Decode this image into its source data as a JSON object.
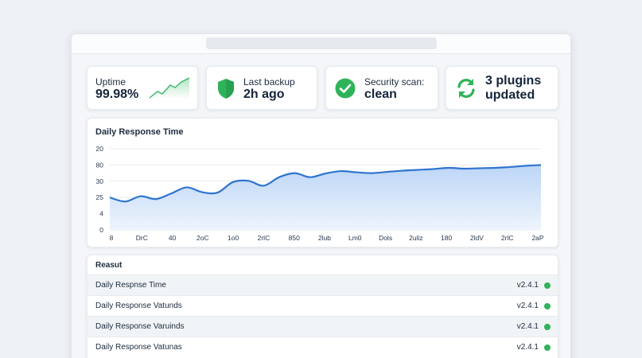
{
  "stats": [
    {
      "label": "Uptime",
      "value": "99.98%",
      "icon": "sparkline-icon"
    },
    {
      "label": "Last backup",
      "value": "2h ago",
      "icon": "shield-icon"
    },
    {
      "label": "Security scan:",
      "value": "clean",
      "icon": "check-circle-icon"
    },
    {
      "label": "",
      "value": "3 plugins\nupdated",
      "value_line1": "3 plugins",
      "value_line2": "updated",
      "icon": "refresh-icon"
    }
  ],
  "colors": {
    "accent": "#2f74d0",
    "success": "#2fb35a",
    "area_top": "#bcd6f7"
  },
  "chart_data": {
    "type": "area",
    "title": "Daily Response Time",
    "y_tick_labels": [
      "20",
      "80",
      "30",
      "25",
      "4",
      "0"
    ],
    "x_tick_labels": [
      "8",
      "DrC",
      "40",
      "2oC",
      "1o0",
      "2rlC",
      "850",
      "2lub",
      "Lm0",
      "Dols",
      "2uliz",
      "180",
      "2ldV",
      "2rlC",
      "2aP"
    ],
    "ylim": [
      0,
      20
    ],
    "x": [
      0,
      1,
      2,
      3,
      4,
      5,
      6,
      7,
      8,
      9,
      10,
      11,
      12,
      13,
      14,
      15,
      16,
      17,
      18,
      19,
      20,
      21,
      22,
      23,
      24,
      25,
      26,
      27,
      28
    ],
    "values": [
      8.0,
      7.0,
      8.3,
      7.6,
      9.0,
      10.5,
      9.3,
      9.2,
      11.8,
      12.1,
      10.9,
      13.0,
      14.0,
      13.0,
      13.9,
      14.5,
      14.2,
      14.0,
      14.3,
      14.6,
      14.8,
      15.0,
      15.3,
      15.1,
      15.2,
      15.3,
      15.5,
      15.8,
      16.0
    ],
    "legend": "none",
    "grid": true
  },
  "table": {
    "header": "Reasut",
    "rows": [
      {
        "name": "Daily Respnse Time",
        "version": "v2.4.1",
        "status": "ok"
      },
      {
        "name": "Daily Response Vatunds",
        "version": "v2.4.1",
        "status": "ok"
      },
      {
        "name": "Daily Response Varuinds",
        "version": "v2.4.1",
        "status": "ok"
      },
      {
        "name": "Daily Response Vatunas",
        "version": "v2.4.1",
        "status": "ok"
      }
    ]
  }
}
